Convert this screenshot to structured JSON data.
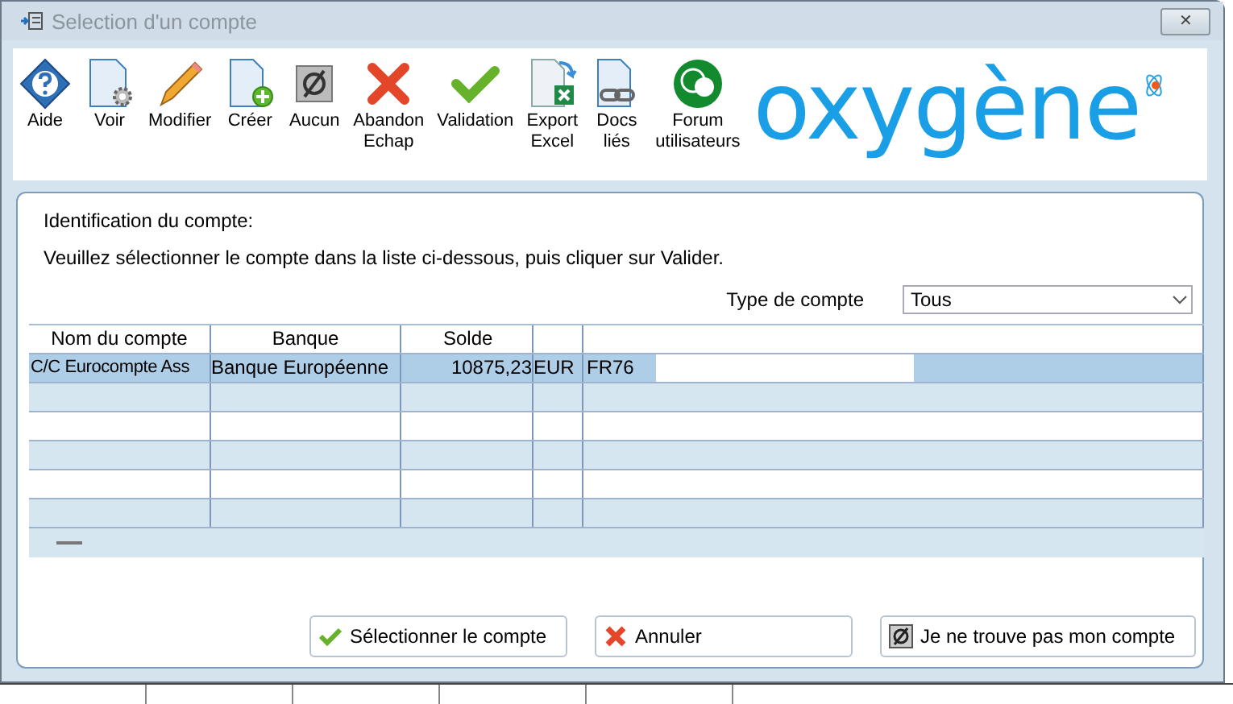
{
  "window": {
    "title": "Selection d'un compte",
    "close": "✕"
  },
  "toolbar": [
    {
      "kind": "help",
      "label": "Aide"
    },
    {
      "kind": "view",
      "label": "Voir"
    },
    {
      "kind": "edit",
      "label": "Modifier"
    },
    {
      "kind": "create",
      "label": "Créer"
    },
    {
      "kind": "none",
      "label": "Aucun"
    },
    {
      "kind": "cancel",
      "label": "Abandon\nEchap"
    },
    {
      "kind": "ok",
      "label": "Validation"
    },
    {
      "kind": "excel",
      "label": "Export\nExcel"
    },
    {
      "kind": "docs",
      "label": "Docs\nliés"
    },
    {
      "kind": "forum",
      "label": "Forum\nutilisateurs"
    }
  ],
  "logo": "oxygène",
  "intro": "Identification du compte:",
  "instruction": "Veuillez sélectionner le compte dans la liste ci-dessous, puis cliquer sur Valider.",
  "filter": {
    "label": "Type de compte",
    "value": "Tous"
  },
  "table": {
    "columns": [
      "Nom du compte",
      "Banque",
      "Solde"
    ],
    "rows": [
      {
        "cells": [
          "C/C Eurocompte Ass",
          "Banque Européenne",
          "10875,23",
          "EUR",
          "FR76"
        ],
        "selected": true
      }
    ]
  },
  "buttons": [
    {
      "kind": "ok",
      "label": "Sélectionner le compte"
    },
    {
      "kind": "cancel",
      "label": "Annuler"
    },
    {
      "kind": "none",
      "label": "Je ne trouve pas mon compte"
    }
  ]
}
